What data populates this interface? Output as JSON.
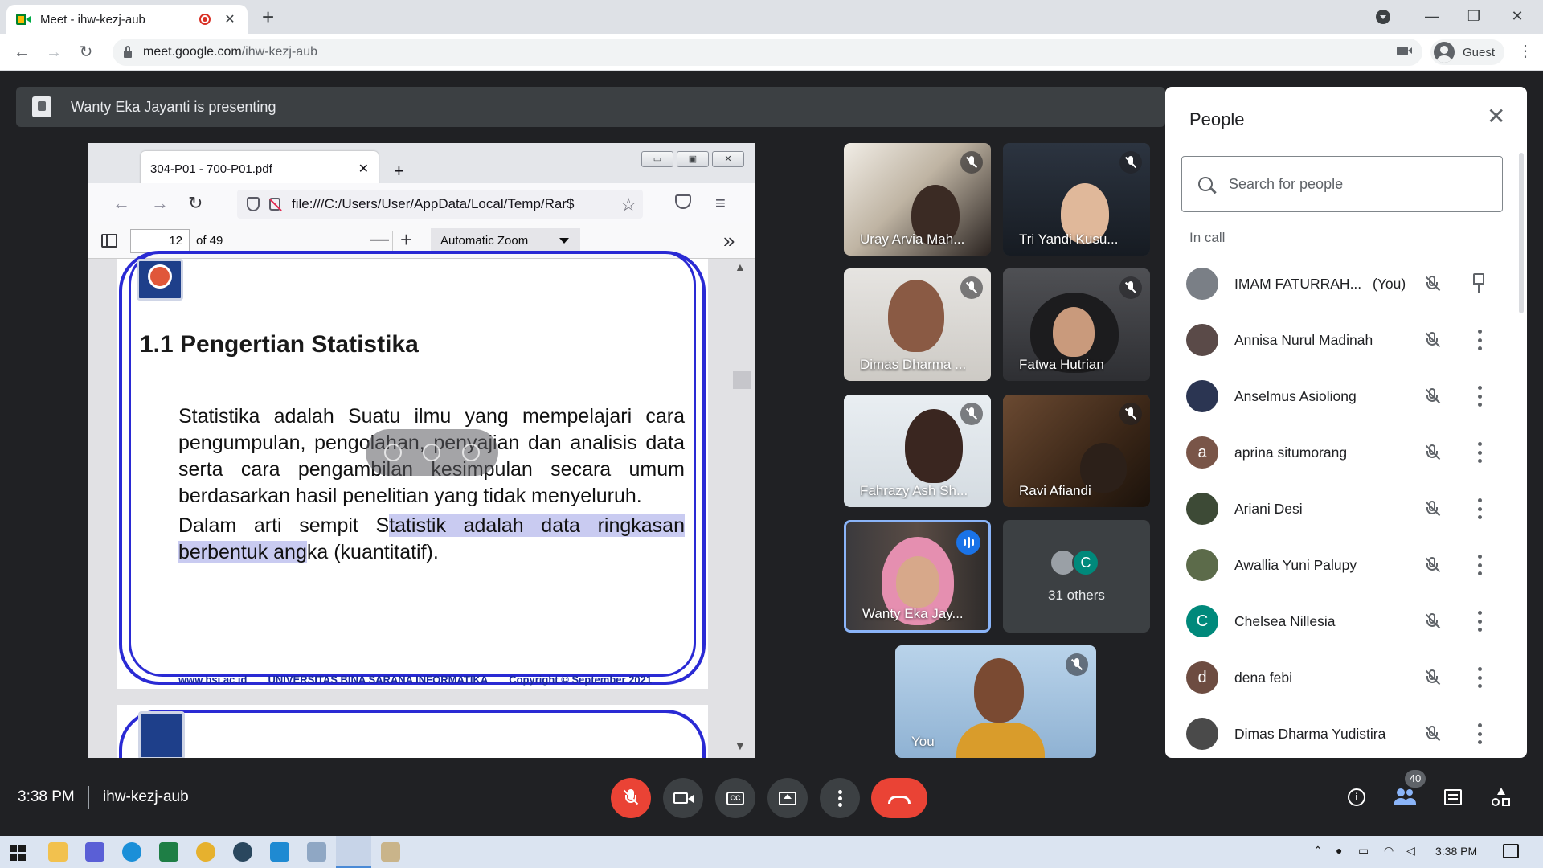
{
  "browser": {
    "tab_title": "Meet - ihw-kezj-aub",
    "url_host": "meet.google.com",
    "url_path": "/ihw-kezj-aub",
    "profile_label": "Guest"
  },
  "presenter": {
    "text": "Wanty Eka Jayanti is presenting"
  },
  "shared_screen": {
    "tab_title": "304-P01 - 700-P01.pdf",
    "url": "file:///C:/Users/User/AppData/Local/Temp/Rar$",
    "page_number": "12",
    "page_of": "of 49",
    "zoom": "Automatic Zoom",
    "heading": "1.1 Pengertian Statistika",
    "para1": "Statistika adalah Suatu ilmu yang mempelajari cara pengumpulan, pengolahan, penyajian dan analisis data serta cara pengambilan kesimpulan secara umum berdasarkan hasil penelitian yang tidak menyeluruh.",
    "para2_pre": "Dalam arti sempit S",
    "para2_hl1": "tatistik adalah data ringkasan",
    "para2_hl2": "berbentuk ang",
    "para2_post": "ka (kuantitatif).",
    "footer_site": "www.bsi.ac.id",
    "footer_univ": "UNIVERSITAS BINA SARANA INFORMATIKA",
    "footer_copy": "Copyright © September 2021"
  },
  "tiles": [
    {
      "name": "Uray Arvia Mah...",
      "muted": true
    },
    {
      "name": "Tri Yandi Kusu...",
      "muted": true
    },
    {
      "name": "Dimas Dharma ...",
      "muted": true
    },
    {
      "name": "Fatwa Hutrian",
      "muted": true
    },
    {
      "name": "Fahrazy Ash Sh...",
      "muted": true
    },
    {
      "name": "Ravi Afiandi",
      "muted": true
    },
    {
      "name": "Wanty Eka Jay...",
      "muted": false
    },
    {
      "name": "You",
      "muted": true
    }
  ],
  "others": {
    "label": "31 others",
    "avatar_letter": "C"
  },
  "people_panel": {
    "title": "People",
    "search_placeholder": "Search for people",
    "section_label": "In call",
    "you_label": "(You)",
    "people": [
      {
        "name": "IMAM FATURRAH...",
        "avatar_letter": "",
        "avatar_color": "#7a7f86"
      },
      {
        "name": "Annisa Nurul Madinah",
        "avatar_letter": "",
        "avatar_color": "#5a4a48"
      },
      {
        "name": "Anselmus Asioliong",
        "avatar_letter": "",
        "avatar_color": "#2b3552"
      },
      {
        "name": "aprina situmorang",
        "avatar_letter": "a",
        "avatar_color": "#795548"
      },
      {
        "name": "Ariani Desi",
        "avatar_letter": "",
        "avatar_color": "#3d4a36"
      },
      {
        "name": "Awallia Yuni Palupy",
        "avatar_letter": "",
        "avatar_color": "#5c6b4a"
      },
      {
        "name": "Chelsea Nillesia",
        "avatar_letter": "C",
        "avatar_color": "#00897b"
      },
      {
        "name": "dena febi",
        "avatar_letter": "d",
        "avatar_color": "#6d4c41"
      },
      {
        "name": "Dimas Dharma Yudistira",
        "avatar_letter": "",
        "avatar_color": "#4a4a4a"
      }
    ]
  },
  "bottom_bar": {
    "time": "3:38 PM",
    "meeting_code": "ihw-kezj-aub",
    "people_count": "40"
  },
  "taskbar": {
    "clock": "3:38 PM"
  },
  "colors": {
    "meet_bg": "#202124",
    "danger": "#ea4335",
    "accent": "#1a73e8",
    "pdf_border": "#2a2ad4",
    "highlight": "#c9cbf1"
  }
}
